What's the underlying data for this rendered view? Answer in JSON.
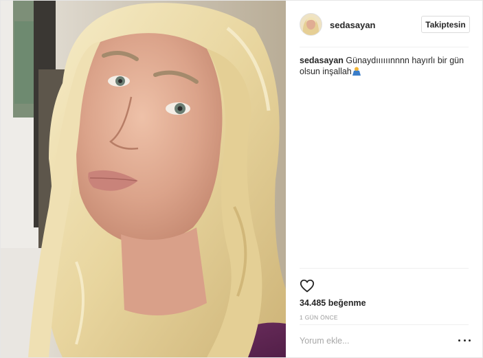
{
  "post": {
    "image_description_icon": "selfie-photo",
    "author": {
      "username": "sedasayan",
      "avatar_icon": "profile-avatar"
    },
    "follow_label": "Takiptesin",
    "caption": {
      "username": "sedasayan",
      "text": "Günaydıııııınnnn hayırlı bir gün olsun inşallah",
      "emoji_icon": "praying-person-emoji"
    },
    "like_icon": "heart-outline-icon",
    "likes_text": "34.485 beğenme",
    "timestamp": "1 GÜN ÖNCE",
    "comment_placeholder": "Yorum ekle...",
    "more_icon": "more-options-icon"
  },
  "colors": {
    "text": "#262626",
    "muted": "#999999",
    "divider": "#efefef",
    "hair": "#ead9a8",
    "shirt": "#6b2a5e"
  }
}
